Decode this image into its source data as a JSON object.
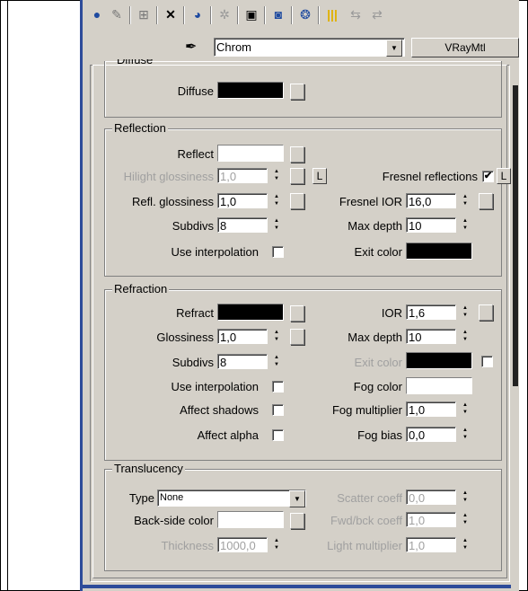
{
  "toolbar": {
    "icons": [
      "sphere-icon",
      "material-map-icon",
      "put-to-scene-icon",
      "delete-icon",
      "make-unique-icon",
      "material-effects-icon",
      "put-to-library-icon",
      "show-in-viewport-icon",
      "show-end-result-icon",
      "go-to-parent-icon",
      "go-forward-sibling-icon",
      "pick-material-icon"
    ]
  },
  "material": {
    "name": "Chrom",
    "type_button": "VRayMtl"
  },
  "diffuse": {
    "group_title": "Diffuse",
    "label": "Diffuse",
    "color": "#000000"
  },
  "reflection": {
    "group_title": "Reflection",
    "reflect_label": "Reflect",
    "reflect_color": "#ffffff",
    "hilight_label": "Hilight glossiness",
    "hilight_value": "1,0",
    "lock_label": "L",
    "fresnel_label": "Fresnel reflections",
    "fresnel_checked": "✔",
    "fresnel_lock_label": "L",
    "refl_gloss_label": "Refl. glossiness",
    "refl_gloss_value": "1,0",
    "fresnel_ior_label": "Fresnel IOR",
    "fresnel_ior_value": "16,0",
    "subdivs_label": "Subdivs",
    "subdivs_value": "8",
    "max_depth_label": "Max depth",
    "max_depth_value": "10",
    "use_interp_label": "Use interpolation",
    "exit_color_label": "Exit color",
    "exit_color": "#000000"
  },
  "refraction": {
    "group_title": "Refraction",
    "refract_label": "Refract",
    "refract_color": "#000000",
    "ior_label": "IOR",
    "ior_value": "1,6",
    "gloss_label": "Glossiness",
    "gloss_value": "1,0",
    "max_depth_label": "Max depth",
    "max_depth_value": "10",
    "subdivs_label": "Subdivs",
    "subdivs_value": "8",
    "exit_color_label": "Exit color",
    "exit_color": "#000000",
    "use_interp_label": "Use interpolation",
    "fog_color_label": "Fog color",
    "fog_color": "#ffffff",
    "affect_shadows_label": "Affect shadows",
    "fog_mult_label": "Fog multiplier",
    "fog_mult_value": "1,0",
    "affect_alpha_label": "Affect alpha",
    "fog_bias_label": "Fog bias",
    "fog_bias_value": "0,0"
  },
  "translucency": {
    "group_title": "Translucency",
    "type_label": "Type",
    "type_value": "None",
    "scatter_label": "Scatter coeff",
    "scatter_value": "0,0",
    "backside_label": "Back-side color",
    "backside_color": "#ffffff",
    "fwd_label": "Fwd/bck coeff",
    "fwd_value": "1,0",
    "thickness_label": "Thickness",
    "thickness_value": "1000,0",
    "light_mult_label": "Light multiplier",
    "light_mult_value": "1,0"
  }
}
